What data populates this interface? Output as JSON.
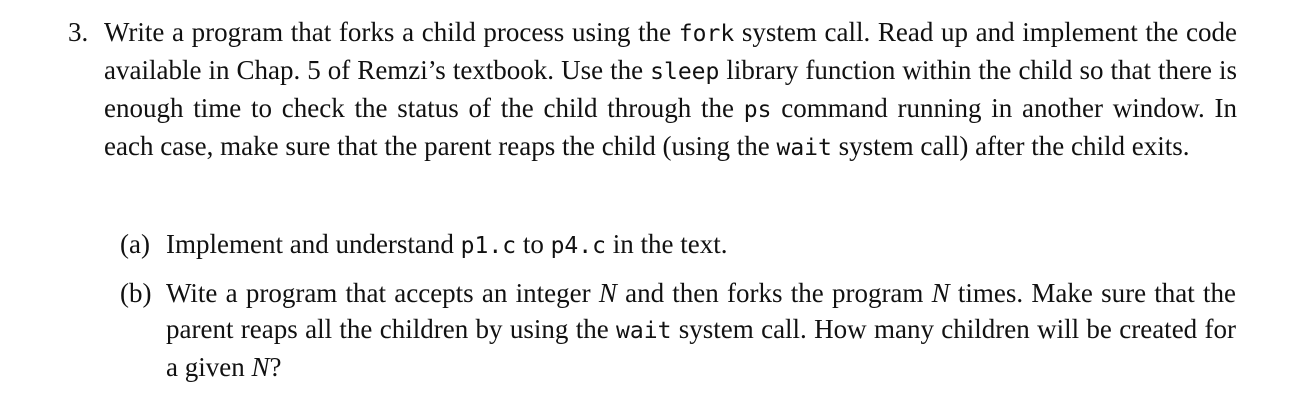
{
  "question": {
    "number": "3.",
    "segments": [
      "Write a program that forks a child process using the ",
      "fork",
      " system call. Read up and implement the code available in Chap. 5 of Remzi’s textbook. Use the ",
      "sleep",
      " library function within the child so that there is enough time to check the status of the child through the ",
      "ps",
      " command running in another window. In each case, make sure that the parent reaps the child (using the ",
      "wait",
      " system call) after the child exits."
    ]
  },
  "subquestions": {
    "a": {
      "label": "(a)",
      "segments": [
        "Implement and understand ",
        "p1.c",
        " to ",
        "p4.c",
        " in the text."
      ]
    },
    "b": {
      "label": "(b)",
      "segments": [
        "Wite a program that accepts an integer ",
        "N",
        " and then forks the program ",
        "N",
        " times. Make sure that the parent reaps all the children by using the ",
        "wait",
        " system call. How many children will be created for a given ",
        "N",
        "?"
      ]
    }
  }
}
